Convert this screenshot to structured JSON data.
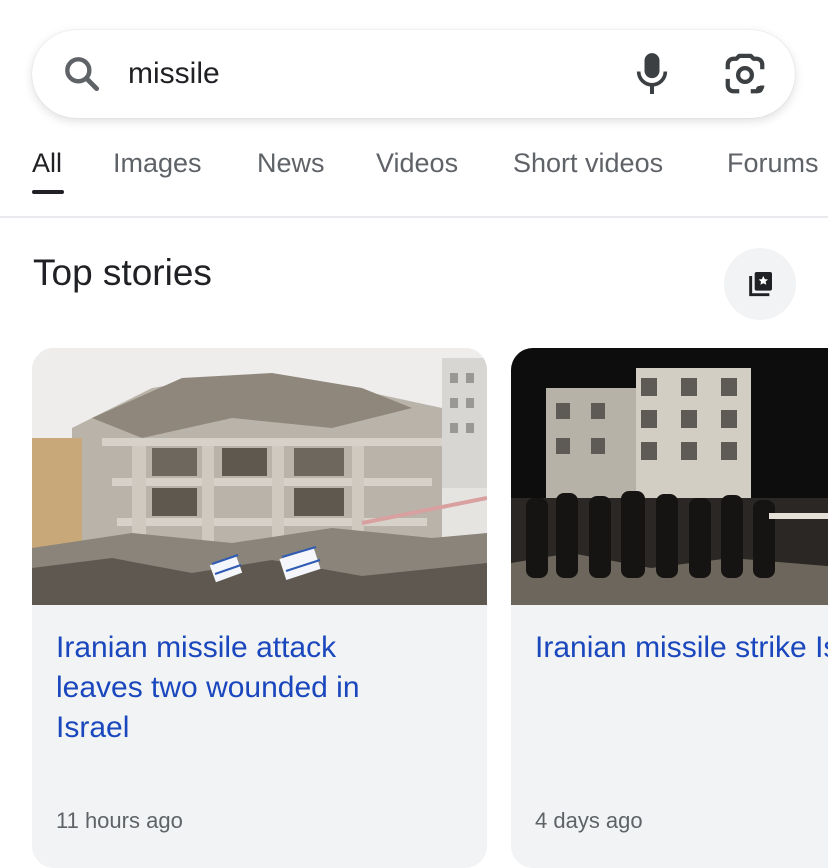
{
  "search": {
    "query": "missile"
  },
  "icons": {
    "search": "search-icon",
    "mic": "microphone-icon",
    "lens": "google-lens-camera-icon",
    "stories": "bookmark-collection-icon"
  },
  "tabs": [
    {
      "label": "All",
      "active": true
    },
    {
      "label": "Images"
    },
    {
      "label": "News"
    },
    {
      "label": "Videos"
    },
    {
      "label": "Short videos"
    },
    {
      "label": "Forums"
    }
  ],
  "top_stories": {
    "title": "Top stories",
    "cards": [
      {
        "headline": "Iranian missile attack\nleaves two wounded in\nIsrael",
        "time": "11 hours ago"
      },
      {
        "headline": "Iranian missile strike\nIsraeli nuclear facili\nafter Tehran says o\nits sites targeted",
        "time": "4 days ago"
      }
    ]
  },
  "colors": {
    "link_blue": "#1a47bd",
    "muted_text": "#5f6368",
    "card_bg": "#f1f3f4"
  }
}
